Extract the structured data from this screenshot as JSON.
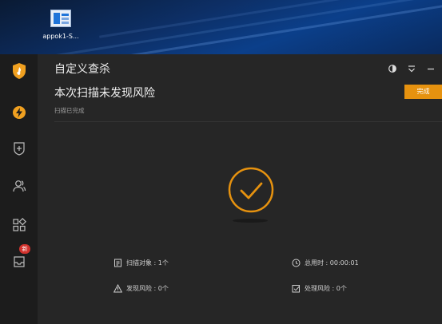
{
  "desktop": {
    "shortcut_label": "appok1-S..."
  },
  "window": {
    "title": "自定义查杀",
    "headline": "本次扫描未发现风险",
    "subline": "扫描已完成",
    "done_button": "完成"
  },
  "sidebar": {
    "items": [
      {
        "icon": "shield-logo-icon"
      },
      {
        "icon": "lightning-icon"
      },
      {
        "icon": "shield-plus-icon"
      },
      {
        "icon": "users-icon"
      },
      {
        "icon": "apps-grid-icon"
      },
      {
        "icon": "inbox-icon",
        "badge": "新"
      }
    ]
  },
  "stats": {
    "scan_objects": "扫描对象 : 1个",
    "total_time": "总用时 : 00:00:01",
    "found_risks": "发现风险 : 0个",
    "handled_risks": "处理风险 : 0个"
  },
  "colors": {
    "accent": "#e6920f",
    "background": "#262626",
    "sidebar": "#1c1c1c"
  }
}
